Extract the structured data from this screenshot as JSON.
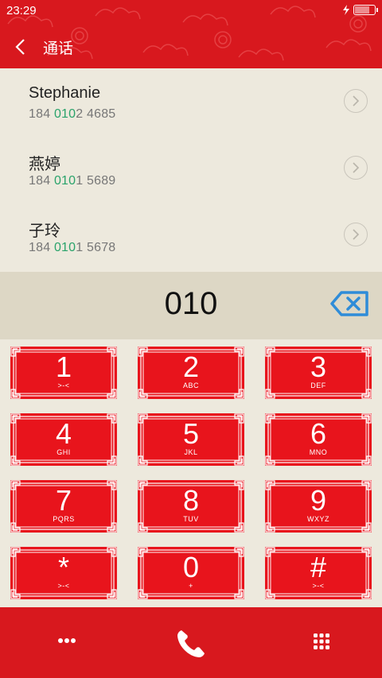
{
  "status": {
    "time": "23:29"
  },
  "header": {
    "title": "通话"
  },
  "contacts": [
    {
      "name": "Stephanie",
      "number_prefix": "184 ",
      "number_match": "010",
      "number_suffix": "2 4685"
    },
    {
      "name": "燕婷",
      "number_prefix": "184 ",
      "number_match": "010",
      "number_suffix": "1 5689"
    },
    {
      "name": "子玲",
      "number_prefix": "184 ",
      "number_match": "010",
      "number_suffix": "1 5678"
    }
  ],
  "dial_input": {
    "value": "010"
  },
  "keys": [
    {
      "digit": "1",
      "letters": ">-<"
    },
    {
      "digit": "2",
      "letters": "ABC"
    },
    {
      "digit": "3",
      "letters": "DEF"
    },
    {
      "digit": "4",
      "letters": "GHI"
    },
    {
      "digit": "5",
      "letters": "JKL"
    },
    {
      "digit": "6",
      "letters": "MNO"
    },
    {
      "digit": "7",
      "letters": "PQRS"
    },
    {
      "digit": "8",
      "letters": "TUV"
    },
    {
      "digit": "9",
      "letters": "WXYZ"
    },
    {
      "digit": "*",
      "letters": ">-<"
    },
    {
      "digit": "0",
      "letters": "+"
    },
    {
      "digit": "#",
      "letters": ">-<"
    }
  ],
  "colors": {
    "primary_red": "#d8181e",
    "key_red": "#e8141c",
    "highlight_green": "#2aa36b",
    "backspace_blue": "#2f8cd8",
    "background": "#ede9dd",
    "input_bg": "#ddd7c5"
  },
  "icons": {
    "back": "chevron-left-icon",
    "detail": "chevron-right-circle-icon",
    "backspace": "backspace-icon",
    "more": "more-dots-icon",
    "call": "phone-icon",
    "keypad": "dialpad-grid-icon",
    "charging": "lightning-icon",
    "battery": "battery-icon"
  }
}
